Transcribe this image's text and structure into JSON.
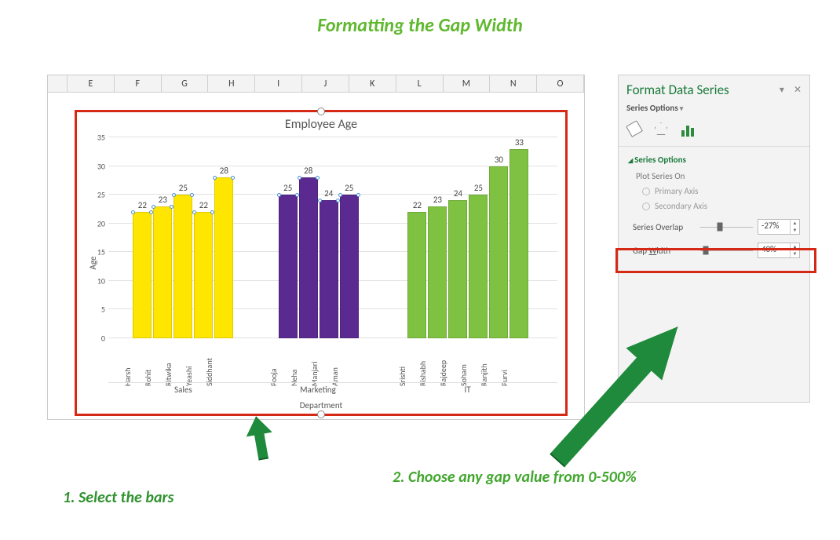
{
  "page_heading": "Formatting the Gap Width",
  "annotations": {
    "step1": "1. Select the bars",
    "step2": "2. Choose any gap value from 0-500%"
  },
  "columns": [
    "E",
    "F",
    "G",
    "H",
    "I",
    "J",
    "K",
    "L",
    "M",
    "N",
    "O"
  ],
  "chart_data": {
    "type": "bar",
    "title": "Employee Age",
    "xlabel": "Department",
    "ylabel": "Age",
    "ylim": [
      0,
      35
    ],
    "yticks": [
      0,
      5,
      10,
      15,
      20,
      25,
      30,
      35
    ],
    "groups": [
      {
        "name": "Sales",
        "color": "#ffe600",
        "items": [
          {
            "label": "Harsh",
            "value": 22
          },
          {
            "label": "Rohit",
            "value": 23
          },
          {
            "label": "Ritwika",
            "value": 25
          },
          {
            "label": "Yeashi",
            "value": 22
          },
          {
            "label": "Siddhant",
            "value": 28
          }
        ]
      },
      {
        "name": "Marketing",
        "color": "#5a2a90",
        "items": [
          {
            "label": "Pooja",
            "value": 25
          },
          {
            "label": "Neha",
            "value": 28
          },
          {
            "label": "Manjari",
            "value": 24
          },
          {
            "label": "Aman",
            "value": 25
          }
        ]
      },
      {
        "name": "IT",
        "color": "#7fc241",
        "items": [
          {
            "label": "Srishti",
            "value": 22
          },
          {
            "label": "Rishabh",
            "value": 23
          },
          {
            "label": "Rajdeep",
            "value": 24
          },
          {
            "label": "Soham",
            "value": 25
          },
          {
            "label": "Ranjith",
            "value": 30
          },
          {
            "label": "Purvi",
            "value": 33
          }
        ]
      }
    ]
  },
  "format_pane": {
    "title": "Format Data Series",
    "subtitle": "Series Options",
    "section": "Series Options",
    "plot_on_label": "Plot Series On",
    "radio1": "Primary Axis",
    "radio2": "Secondary Axis",
    "overlap_label": "Series Overlap",
    "overlap_value": "-27%",
    "gap_label": "Gap Width",
    "gap_value": "40%",
    "gap_underline_char": "W"
  }
}
